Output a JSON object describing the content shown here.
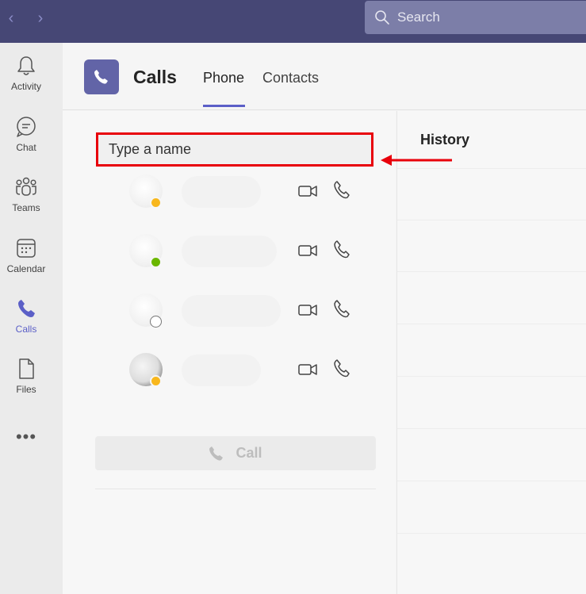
{
  "topbar": {
    "search_placeholder": "Search"
  },
  "rail": {
    "items": [
      {
        "label": "Activity"
      },
      {
        "label": "Chat"
      },
      {
        "label": "Teams"
      },
      {
        "label": "Calendar"
      },
      {
        "label": "Calls",
        "active": true
      },
      {
        "label": "Files"
      }
    ],
    "more": "•••"
  },
  "header": {
    "title": "Calls",
    "tabs": [
      {
        "label": "Phone",
        "selected": true
      },
      {
        "label": "Contacts"
      }
    ]
  },
  "dialer": {
    "input_placeholder": "Type a name",
    "contacts": [
      {
        "presence": "away"
      },
      {
        "presence": "available"
      },
      {
        "presence": "offline"
      },
      {
        "presence": "away"
      }
    ],
    "call_label": "Call"
  },
  "history": {
    "title": "History"
  },
  "colors": {
    "topbar": "#464775",
    "accent": "#5b5fc7",
    "highlight_box": "#e8000b",
    "away": "#f8b71d",
    "available": "#6bb700"
  }
}
